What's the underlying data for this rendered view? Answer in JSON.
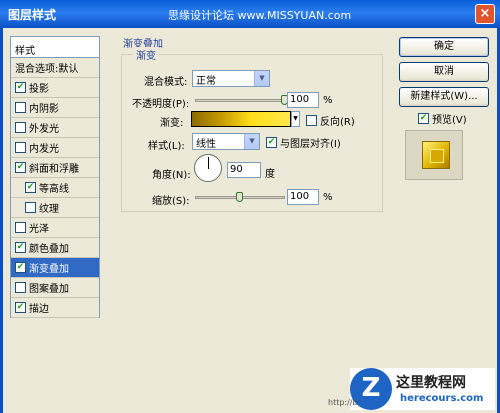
{
  "window": {
    "title": "图层样式",
    "watermark": "思缘设计论坛 www.MISSYUAN.com",
    "close": "×"
  },
  "stylelist": {
    "header": "样式",
    "items": [
      {
        "label": "混合选项:默认",
        "checkbox": false,
        "checked": false,
        "sub": false,
        "selected": false
      },
      {
        "label": "投影",
        "checkbox": true,
        "checked": true,
        "sub": false,
        "selected": false
      },
      {
        "label": "内阴影",
        "checkbox": true,
        "checked": false,
        "sub": false,
        "selected": false
      },
      {
        "label": "外发光",
        "checkbox": true,
        "checked": false,
        "sub": false,
        "selected": false
      },
      {
        "label": "内发光",
        "checkbox": true,
        "checked": false,
        "sub": false,
        "selected": false
      },
      {
        "label": "斜面和浮雕",
        "checkbox": true,
        "checked": true,
        "sub": false,
        "selected": false
      },
      {
        "label": "等高线",
        "checkbox": true,
        "checked": true,
        "sub": true,
        "selected": false
      },
      {
        "label": "纹理",
        "checkbox": true,
        "checked": false,
        "sub": true,
        "selected": false
      },
      {
        "label": "光泽",
        "checkbox": true,
        "checked": false,
        "sub": false,
        "selected": false
      },
      {
        "label": "颜色叠加",
        "checkbox": true,
        "checked": true,
        "sub": false,
        "selected": false
      },
      {
        "label": "渐变叠加",
        "checkbox": true,
        "checked": true,
        "sub": false,
        "selected": true
      },
      {
        "label": "图案叠加",
        "checkbox": true,
        "checked": false,
        "sub": false,
        "selected": false
      },
      {
        "label": "描边",
        "checkbox": true,
        "checked": true,
        "sub": false,
        "selected": false
      }
    ]
  },
  "panel": {
    "section_title": "渐变叠加",
    "group_title": "渐变",
    "blend_mode_label": "混合模式:",
    "blend_mode_value": "正常",
    "opacity_label": "不透明度(P):",
    "opacity_value": "100",
    "opacity_unit": "%",
    "opacity_fraction": 1.0,
    "gradient_label": "渐变:",
    "reverse_label": "反向(R)",
    "reverse_checked": false,
    "style_label": "样式(L):",
    "style_value": "线性",
    "align_label": "与图层对齐(I)",
    "align_checked": true,
    "angle_label": "角度(N):",
    "angle_value": "90",
    "angle_unit": "度",
    "scale_label": "缩放(S):",
    "scale_value": "100",
    "scale_unit": "%",
    "scale_fraction": 0.5
  },
  "buttons": {
    "ok": "确定",
    "cancel": "取消",
    "new_style": "新建样式(W)...",
    "preview_label": "预览(V)",
    "preview_checked": true
  },
  "footer": {
    "logo_letter": "Z",
    "logo_cn": "这里教程网",
    "logo_en": "herecours.com",
    "url_fragment": "http://b"
  },
  "check_glyph": "✔"
}
